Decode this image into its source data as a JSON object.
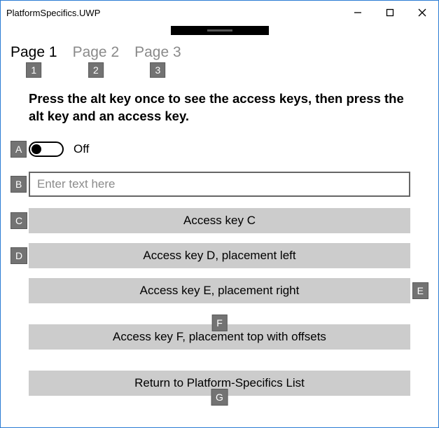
{
  "window": {
    "title": "PlatformSpecifics.UWP"
  },
  "tabs": [
    {
      "label": "Page 1",
      "key": "1",
      "active": true
    },
    {
      "label": "Page 2",
      "key": "2",
      "active": false
    },
    {
      "label": "Page 3",
      "key": "3",
      "active": false
    }
  ],
  "instructions": "Press the alt key once to see the access keys, then press the alt key and an access key.",
  "toggle": {
    "state_label": "Off",
    "key": "A"
  },
  "text_input": {
    "placeholder": "Enter text here",
    "key": "B"
  },
  "buttons": {
    "c": {
      "label": "Access key C",
      "key": "C"
    },
    "d": {
      "label": "Access key D, placement left",
      "key": "D"
    },
    "e": {
      "label": "Access key E, placement right",
      "key": "E"
    },
    "f": {
      "label": "Access key F, placement top with offsets",
      "key": "F"
    },
    "g": {
      "label": "Return to Platform-Specifics List",
      "key": "G"
    }
  }
}
